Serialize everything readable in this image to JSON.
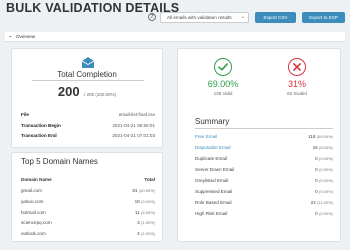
{
  "page_title": "BULK VALIDATION DETAILS",
  "toolbar": {
    "help_icon": "question-circle-icon",
    "help_glyph": "?",
    "filter_value": "All emails with validation results",
    "export_csv_label": "Export CSV",
    "export_esp_label": "Export to ESP"
  },
  "overview": {
    "label": "Overview",
    "toggle_glyph": "−"
  },
  "completion": {
    "icon": "envelope-open-icon",
    "title": "Total Completion",
    "count": "200",
    "count_detail": "/ 200 (100.00%)",
    "file_label": "File",
    "file_value": "email-list-final.csv",
    "begin_label": "Transaction Begin",
    "begin_value": "2021-04-21 06:50:01",
    "end_label": "Transaction End",
    "end_value": "2021-04-21 07:01:03"
  },
  "domains": {
    "title": "Top 5 Domain Names",
    "col_domain": "Domain Name",
    "col_total": "Total",
    "rows": [
      {
        "name": "gmail.com",
        "total": "81",
        "pct": "(40.50%)"
      },
      {
        "name": "yahoo.com",
        "total": "18",
        "pct": "(9.00%)"
      },
      {
        "name": "hotmail.com",
        "total": "11",
        "pct": "(5.50%)"
      },
      {
        "name": "sciencepq.com",
        "total": "3",
        "pct": "(1.50%)"
      },
      {
        "name": "outlook.com",
        "total": "2",
        "pct": "(1.00%)"
      }
    ]
  },
  "stats": {
    "valid_icon": "check-circle-icon",
    "valid_percent": "69.00%",
    "valid_label": "138 Valid",
    "invalid_icon": "x-circle-icon",
    "invalid_percent": "31%",
    "invalid_label": "62 Invalid",
    "ok_color": "#2e9e4b",
    "err_color": "#d9333f"
  },
  "summary": {
    "title": "Summary",
    "rows": [
      {
        "label": "Free Email",
        "value": "118",
        "pct": "(59.00%)",
        "link": true
      },
      {
        "label": "Disposable Email",
        "value": "16",
        "pct": "(8.00%)",
        "link": true
      },
      {
        "label": "Duplicate Email",
        "value": "0",
        "pct": "(0.00%)",
        "link": false
      },
      {
        "label": "Server Down Email",
        "value": "0",
        "pct": "(0.00%)",
        "link": false
      },
      {
        "label": "Greylisted Email",
        "value": "0",
        "pct": "(0.00%)",
        "link": false
      },
      {
        "label": "Suppressed Email",
        "value": "0",
        "pct": "(0.00%)",
        "link": false
      },
      {
        "label": "Role Based Email",
        "value": "22",
        "pct": "(11.00%)",
        "link": false
      },
      {
        "label": "High Risk Email",
        "value": "0",
        "pct": "(0.00%)",
        "link": false
      }
    ]
  },
  "accent_color": "#3c8dbc"
}
